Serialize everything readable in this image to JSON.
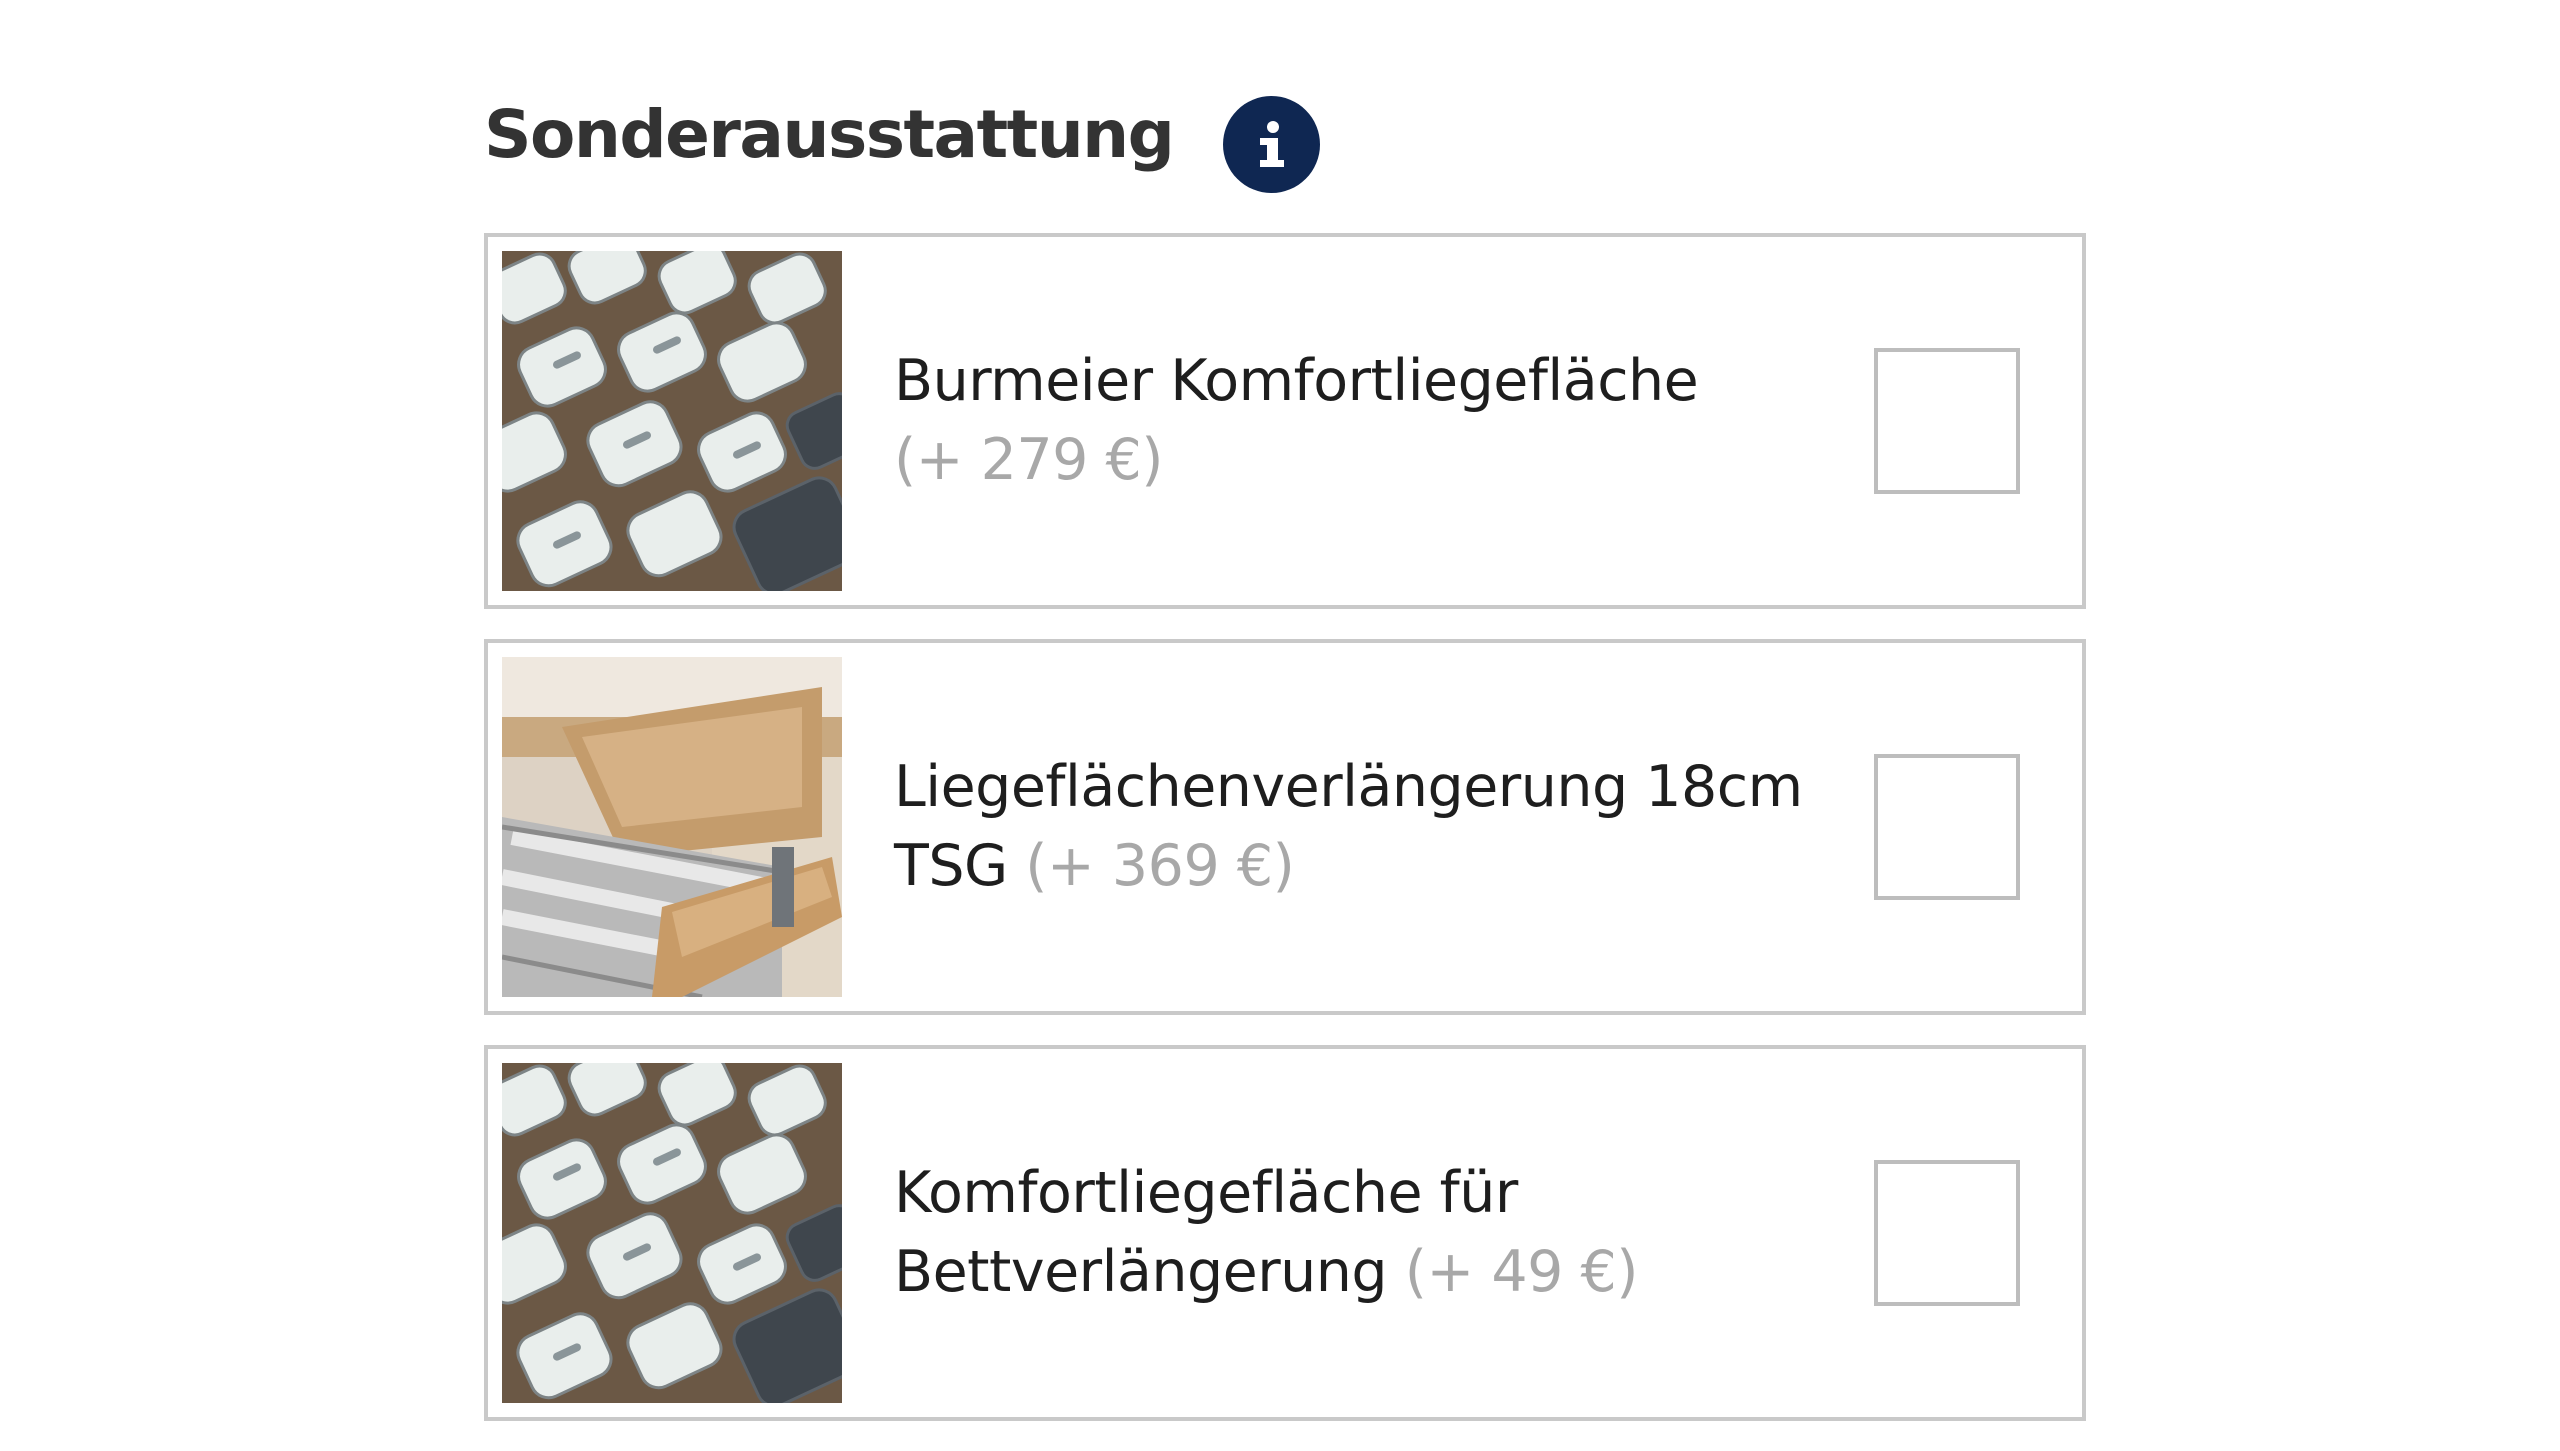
{
  "section": {
    "title": "Sonderausstattung",
    "info_icon": "info-icon",
    "info_color": "#0f2752"
  },
  "options": [
    {
      "name": "Burmeier Komfortliegefläche",
      "name_extra": "",
      "price": "(+ 279 €)",
      "image": "slatted-frame-caps-photo",
      "checked": false
    },
    {
      "name": "Liegeflächenverlängerung 18cm",
      "name_extra": "TSG",
      "price": "(+ 369 €)",
      "image": "bed-frame-extension-photo",
      "checked": false
    },
    {
      "name": "Komfortliegefläche für",
      "name_extra": "Bettverlängerung",
      "price": "(+ 49 €)",
      "image": "slatted-frame-caps-photo",
      "checked": false
    }
  ],
  "colors": {
    "border": "#c9c9c9",
    "price_text": "#a8a8a8",
    "heading_text": "#333333"
  }
}
